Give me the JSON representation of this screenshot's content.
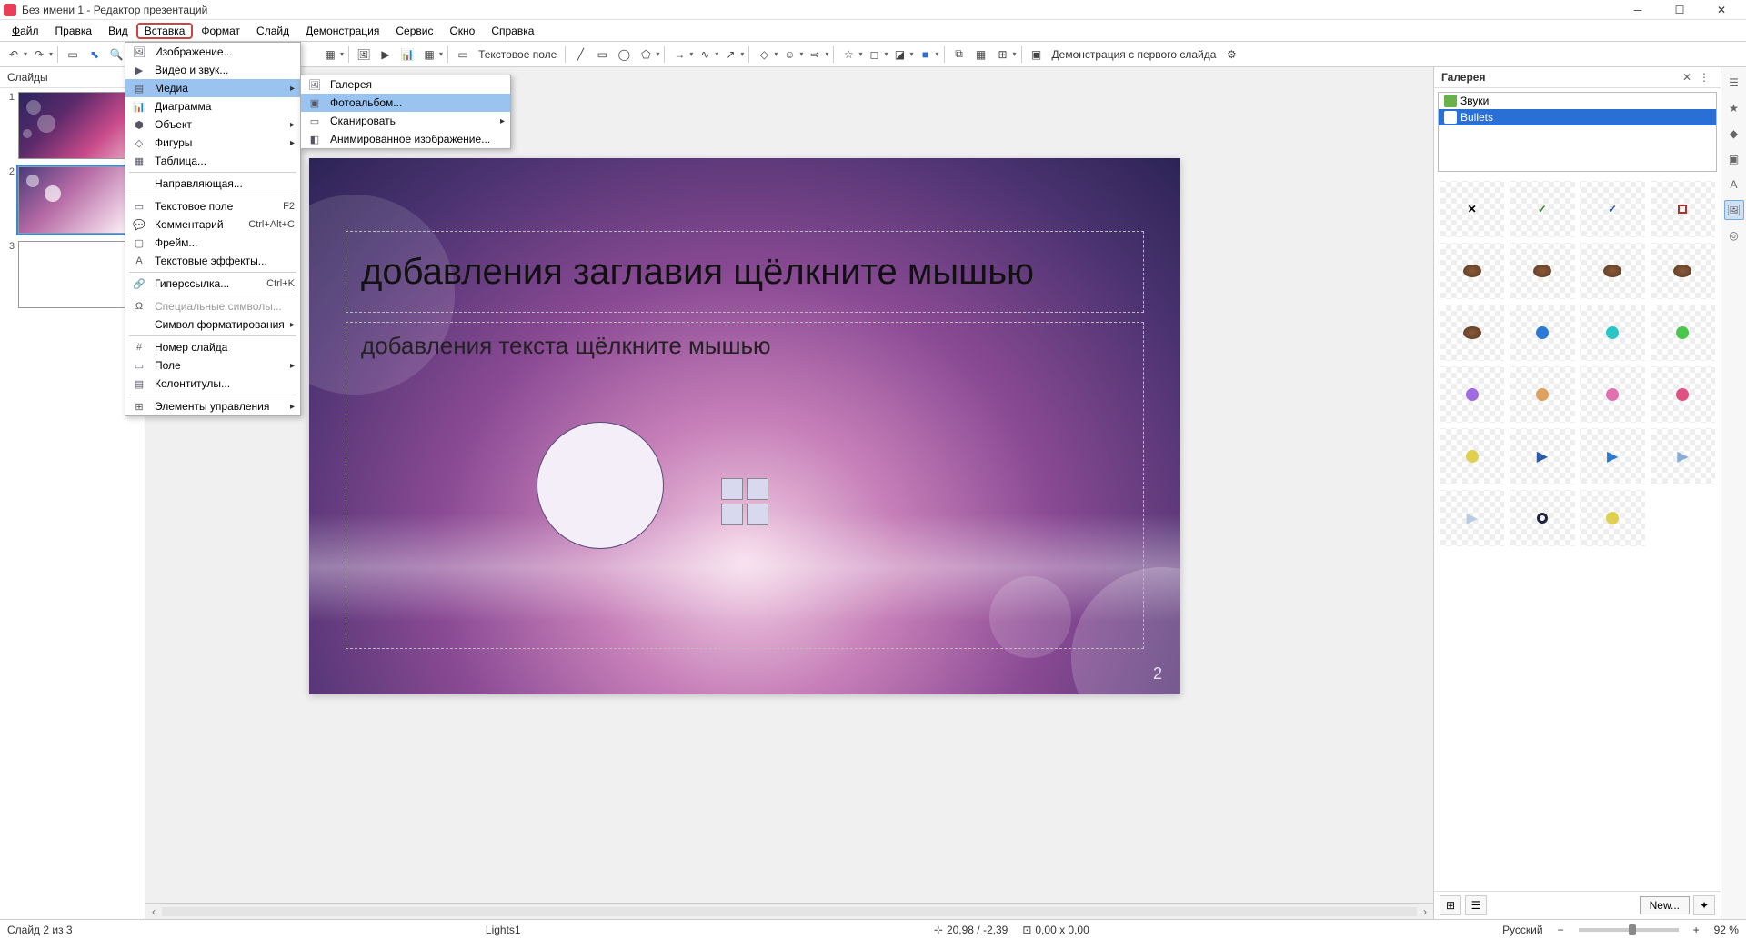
{
  "window": {
    "title": "Без имени 1 - Редактор презентаций"
  },
  "menubar": {
    "file": "Файл",
    "edit": "Правка",
    "view": "Вид",
    "insert": "Вставка",
    "format": "Формат",
    "slide": "Слайд",
    "slideshow": "Демонстрация",
    "tools": "Сервис",
    "window": "Окно",
    "help": "Справка"
  },
  "toolbar": {
    "textbox_label": "Текстовое поле",
    "slideshow_label": "Демонстрация с первого слайда"
  },
  "insert_menu": {
    "image": "Изображение...",
    "video_sound": "Видео и звук...",
    "media": "Медиа",
    "chart": "Диаграмма",
    "object": "Объект",
    "shapes": "Фигуры",
    "table": "Таблица...",
    "guide": "Направляющая...",
    "textbox": "Текстовое поле",
    "textbox_shortcut": "F2",
    "comment": "Комментарий",
    "comment_shortcut": "Ctrl+Alt+C",
    "frame": "Фрейм...",
    "text_effects": "Текстовые эффекты...",
    "hyperlink": "Гиперссылка...",
    "hyperlink_shortcut": "Ctrl+K",
    "special_chars": "Специальные символы...",
    "formatting_mark": "Символ форматирования",
    "slide_number": "Номер слайда",
    "field": "Поле",
    "header_footer": "Колонтитулы...",
    "controls": "Элементы управления"
  },
  "media_submenu": {
    "gallery": "Галерея",
    "photo_album": "Фотоальбом...",
    "scan": "Сканировать",
    "animated_image": "Анимированное изображение..."
  },
  "slide_panel": {
    "title": "Слайды"
  },
  "canvas": {
    "title_placeholder": "добавления заглавия щёлкните мышью",
    "content_placeholder": "добавления текста щёлкните мышью",
    "slide_number": "2"
  },
  "gallery_panel": {
    "title": "Галерея",
    "tree": {
      "sounds": "Звуки",
      "bullets": "Bullets"
    },
    "new_button": "New...",
    "bullets": [
      {
        "type": "x",
        "color": "#000"
      },
      {
        "type": "check",
        "color": "#2a8a2a"
      },
      {
        "type": "check",
        "color": "#2a5aa8"
      },
      {
        "type": "square",
        "color": "#b03030"
      },
      {
        "type": "bean",
        "color": "#8a5a3a"
      },
      {
        "type": "bean",
        "color": "#8a5a3a"
      },
      {
        "type": "bean",
        "color": "#8a5a3a"
      },
      {
        "type": "bean",
        "color": "#8a5a3a"
      },
      {
        "type": "bean",
        "color": "#8a5a3a"
      },
      {
        "type": "dot",
        "color": "#2a7ad6"
      },
      {
        "type": "dot",
        "color": "#2ac6c6"
      },
      {
        "type": "dot",
        "color": "#4ac64a"
      },
      {
        "type": "dot",
        "color": "#a06ae0"
      },
      {
        "type": "dot",
        "color": "#e0a060"
      },
      {
        "type": "dot",
        "color": "#e070b0"
      },
      {
        "type": "dot",
        "color": "#e05080"
      },
      {
        "type": "dot",
        "color": "#e0d050"
      },
      {
        "type": "play",
        "color": "#2a5aa8"
      },
      {
        "type": "play",
        "color": "#2a7ad6"
      },
      {
        "type": "play",
        "color": "#88aed6"
      },
      {
        "type": "play",
        "color": "#b8cce6"
      },
      {
        "type": "ring",
        "color": "#202040"
      },
      {
        "type": "dot",
        "color": "#e0d050"
      }
    ]
  },
  "statusbar": {
    "slide_info": "Слайд 2 из 3",
    "template": "Lights1",
    "cursor_pos": "20,98 / -2,39",
    "object_size": "0,00 x 0,00",
    "language": "Русский",
    "zoom": "92 %"
  }
}
